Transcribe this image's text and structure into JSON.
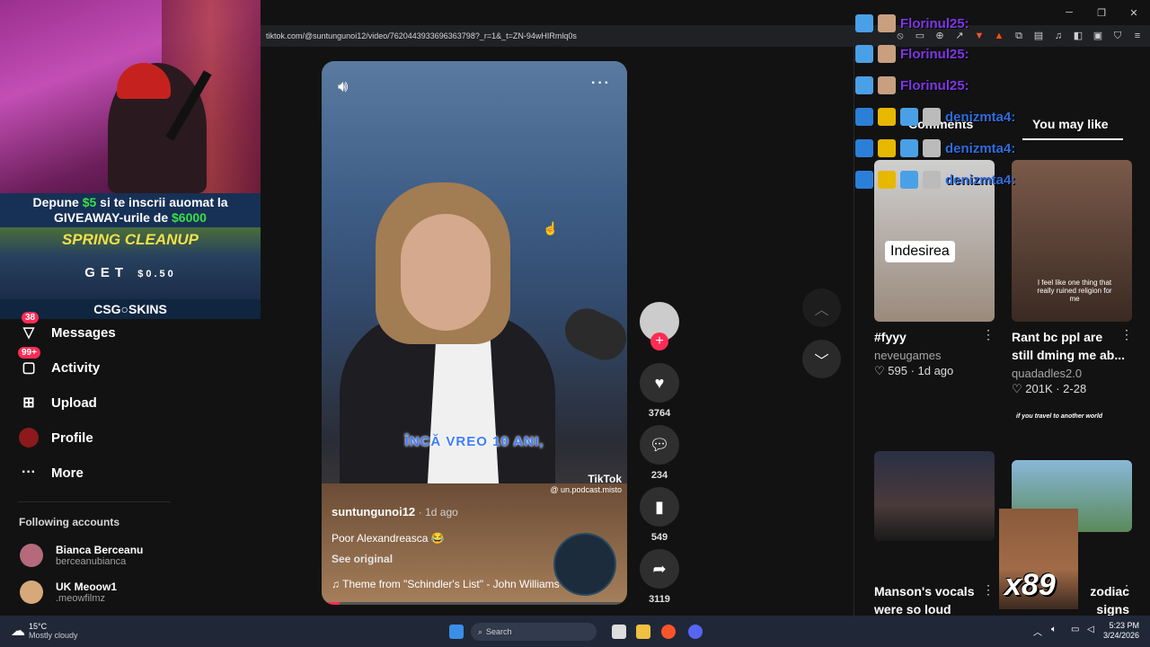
{
  "browser": {
    "url": "tiktok.com/@suntungunoi12/video/7620443933696363798?_r=1&_t=ZN-94wHIRmlq0s"
  },
  "promo": {
    "line1_pre": "Depune",
    "line1_amount": "$5",
    "line1_post": "si te inscrii auomat la",
    "line2_pre": "GIVEAWAY-urile de",
    "line2_amount": "$6000",
    "event": "SPRING CLEANUP",
    "get_text": "GET",
    "get_amount": "$0.50",
    "brand": "CSG○SKINS"
  },
  "nav": {
    "items": [
      {
        "label": "Messages",
        "badge": "38"
      },
      {
        "label": "Activity",
        "badge": "99+"
      },
      {
        "label": "Upload"
      },
      {
        "label": "Profile"
      },
      {
        "label": "More"
      }
    ],
    "following_header": "Following accounts",
    "accounts": [
      {
        "name": "Bianca Berceanu",
        "handle": "berceanubianca"
      },
      {
        "name": "UK Meoow1",
        "handle": ".meowfilmz"
      }
    ]
  },
  "video": {
    "subtitle": "ÎNCĂ VREO 10 ANI,",
    "username": "suntungunoi12",
    "date": "· 1d ago",
    "description": "Poor Alexandreasca 😂",
    "see_original": "See original",
    "music": "♫  Theme from \"Schindler's List\" - John Williams",
    "watermark": "TikTok",
    "watermark_handle": "@ un.podcast.misto",
    "progress": 0.06
  },
  "actions": {
    "likes": "3764",
    "comments": "234",
    "saves": "549",
    "shares": "3119"
  },
  "right_panel": {
    "tabs": [
      "Comments",
      "You may like"
    ],
    "cards": [
      {
        "title": "#fyyy",
        "author": "neveugames",
        "meta": "♡ 595 · 1d ago",
        "thumb_label": "Indesirea"
      },
      {
        "title": "Rant bc ppl are still dming me ab...",
        "author": "quadadles2.0",
        "meta": "♡ 201K · 2-28",
        "thumb_label": "I feel like one thing that really ruined religion for me"
      },
      {
        "title": "Manson's vocals were so loud and...",
        "author": "",
        "meta": ""
      },
      {
        "title": "zodiac signs determine...",
        "author": "",
        "meta": ""
      }
    ],
    "travel_caption": "if you travel to another world"
  },
  "chat": {
    "lines": [
      {
        "name": "Florinul25:"
      },
      {
        "name": "Florinul25:"
      },
      {
        "name": "Florinul25:"
      },
      {
        "name": "denizmta4:"
      },
      {
        "name": "denizmta4:"
      },
      {
        "name": "denizmta4:"
      }
    ],
    "meme_text": "x89"
  },
  "taskbar": {
    "temp": "15°C",
    "weather": "Mostly cloudy",
    "search": "Search",
    "time": "5:23 PM",
    "date": "3/24/2026"
  },
  "colors": {
    "accent": "#fe2c55",
    "chat_purple": "#7e36e8",
    "chat_blue": "#2d6de0"
  }
}
